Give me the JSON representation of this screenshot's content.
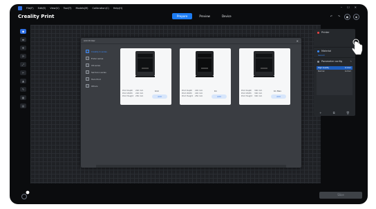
{
  "menu": {
    "items": [
      "File(F)",
      "Edit(E)",
      "View(V)",
      "Tool(T)",
      "Models(M)",
      "Calibration(C)",
      "Help(H)"
    ]
  },
  "app": {
    "title": "Creality Print"
  },
  "tabs": [
    {
      "label": "Prepare",
      "active": true
    },
    {
      "label": "Preview",
      "active": false
    },
    {
      "label": "Device",
      "active": false
    }
  ],
  "dialog": {
    "title": "Add Printer",
    "brands": [
      {
        "label": "Creality K series",
        "active": true
      },
      {
        "label": "Ender series",
        "active": false
      },
      {
        "label": "CR series",
        "active": false
      },
      {
        "label": "Sermoon series",
        "active": false
      },
      {
        "label": "Hero Prod",
        "active": false
      },
      {
        "label": "Others",
        "active": false
      }
    ],
    "printers": [
      {
        "model": "K1C",
        "specs": [
          {
            "label": "Print Depth",
            "value": "220 mm"
          },
          {
            "label": "Print Width",
            "value": "220 mm"
          },
          {
            "label": "Print Height",
            "value": "250 mm"
          }
        ],
        "add_label": "Add"
      },
      {
        "model": "K1",
        "specs": [
          {
            "label": "Print Depth",
            "value": "220 mm"
          },
          {
            "label": "Print Width",
            "value": "220 mm"
          },
          {
            "label": "Print Height",
            "value": "250 mm"
          }
        ],
        "add_label": "Add"
      },
      {
        "model": "K1 Max",
        "specs": [
          {
            "label": "Print Depth",
            "value": "300 mm"
          },
          {
            "label": "Print Width",
            "value": "300 mm"
          },
          {
            "label": "Print Height",
            "value": "300 mm"
          }
        ],
        "add_label": "Add"
      }
    ]
  },
  "right_panel": {
    "printer_label": "Printer",
    "material_label": "Material",
    "material_item": "Generic",
    "param_label": "Parameter config",
    "params": [
      {
        "name": "High Quality",
        "value": "0.1mm",
        "active": true
      },
      {
        "name": "Normal",
        "value": "0.2mm",
        "active": false
      }
    ]
  },
  "slice_button": "Slice",
  "colors": {
    "accent": "#1d7cf2",
    "screen_bg": "#0b0c0e",
    "dialog_bg": "#3a3d42"
  }
}
